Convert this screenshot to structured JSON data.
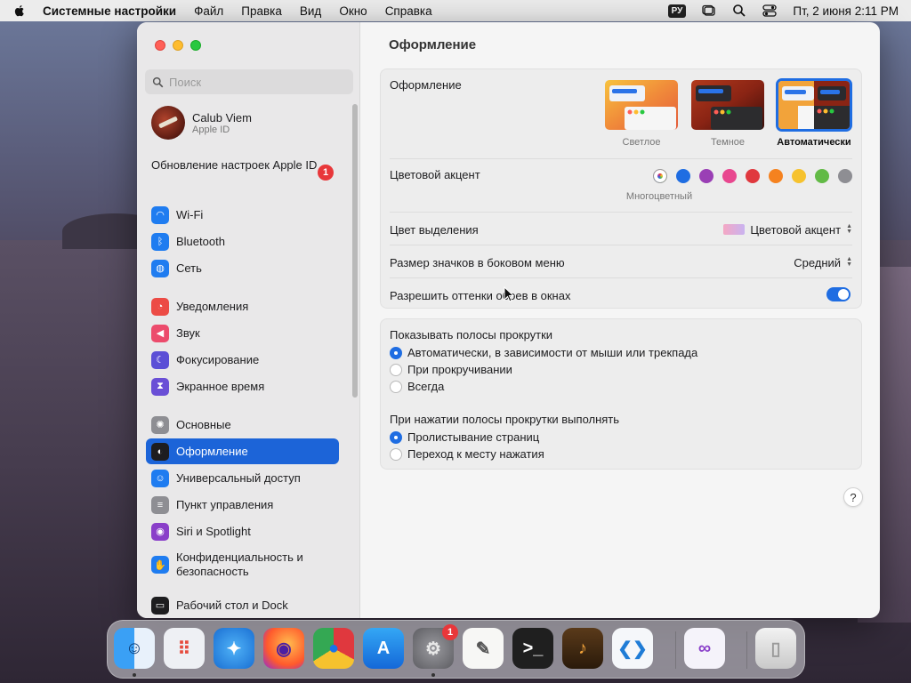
{
  "menubar": {
    "app_name": "Системные настройки",
    "menus": [
      "Файл",
      "Правка",
      "Вид",
      "Окно",
      "Справка"
    ],
    "keyboard_layout": "РУ",
    "datetime": "Пт, 2 июня  2:11 PM"
  },
  "sidebar": {
    "search_placeholder": "Поиск",
    "user": {
      "name": "Calub Viem",
      "subtitle": "Apple ID"
    },
    "update": {
      "label": "Обновление настроек Apple ID",
      "badge": "1"
    },
    "items": [
      {
        "label": "Wi-Fi",
        "icon": "wifi-icon",
        "color": "#1f7cf0"
      },
      {
        "label": "Bluetooth",
        "icon": "bluetooth-icon",
        "color": "#1f7cf0"
      },
      {
        "label": "Сеть",
        "icon": "globe-icon",
        "color": "#1f7cf0"
      },
      {
        "label": "Уведомления",
        "icon": "bell-icon",
        "color": "#ec4b45"
      },
      {
        "label": "Звук",
        "icon": "speaker-icon",
        "color": "#ec4b6c"
      },
      {
        "label": "Фокусирование",
        "icon": "moon-icon",
        "color": "#5b4fd6"
      },
      {
        "label": "Экранное время",
        "icon": "hourglass-icon",
        "color": "#6a4fd6"
      },
      {
        "label": "Основные",
        "icon": "gear-icon",
        "color": "#8e8e93"
      },
      {
        "label": "Оформление",
        "icon": "appearance-icon",
        "color": "#1d1d1f"
      },
      {
        "label": "Универсальный доступ",
        "icon": "accessibility-icon",
        "color": "#1f7cf0"
      },
      {
        "label": "Пункт управления",
        "icon": "control-center-icon",
        "color": "#8e8e93"
      },
      {
        "label": "Siri и Spotlight",
        "icon": "siri-icon",
        "color": "#8a3fc9"
      },
      {
        "label": "Конфиденциальность и безопасность",
        "icon": "hand-icon",
        "color": "#1f7cf0"
      },
      {
        "label": "Рабочий стол и Dock",
        "icon": "dock-icon",
        "color": "#1d1d1f"
      }
    ],
    "selected_index": 8
  },
  "main": {
    "title": "Оформление",
    "appearance": {
      "label": "Оформление",
      "options": [
        "Светлое",
        "Темное",
        "Автоматически"
      ],
      "selected": "Автоматически"
    },
    "accent": {
      "label": "Цветовой акцент",
      "selected_name": "Многоцветный",
      "colors": [
        "multicolor",
        "#1f6de2",
        "#9a3fb5",
        "#e8478f",
        "#e0383e",
        "#f5821f",
        "#f6c22e",
        "#62ba46",
        "#8e8e93"
      ]
    },
    "highlight": {
      "label": "Цвет выделения",
      "value": "Цветовой акцент"
    },
    "sidebar_icon_size": {
      "label": "Размер значков в боковом меню",
      "value": "Средний"
    },
    "wallpaper_tinting": {
      "label": "Разрешить оттенки обоев в окнах",
      "enabled": true
    },
    "scrollbars": {
      "label": "Показывать полосы прокрутки",
      "options": [
        "Автоматически, в зависимости от мыши или трекпада",
        "При прокручивании",
        "Всегда"
      ],
      "selected_index": 0
    },
    "click_scrollbar": {
      "label": "При нажатии полосы прокрутки выполнять",
      "options": [
        "Пролистывание страниц",
        "Переход к месту нажатия"
      ],
      "selected_index": 0
    },
    "help": "?"
  },
  "dock": {
    "apps": [
      "finder-icon",
      "launchpad-icon",
      "safari-icon",
      "firefox-icon",
      "chrome-icon",
      "app-store-icon",
      "system-settings-icon",
      "textedit-icon",
      "terminal-icon",
      "garageband-icon",
      "vscode-icon",
      "visual-studio-icon",
      "trash-icon"
    ],
    "settings_badge": "1"
  }
}
